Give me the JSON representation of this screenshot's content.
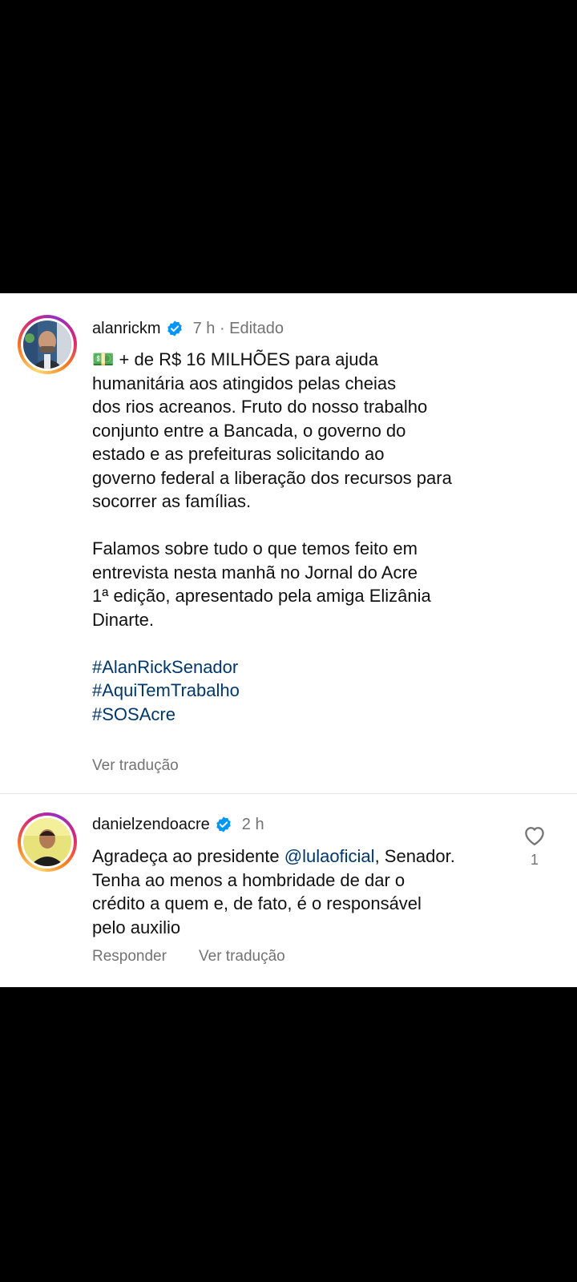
{
  "post": {
    "username": "alanrickm",
    "meta": "7 h · Editado",
    "emoji": "💵",
    "lines": [
      "+ de R$ 16 MILHÕES para ajuda",
      "humanitária aos atingidos pelas cheias",
      "dos rios acreanos. Fruto do nosso trabalho",
      "conjunto entre a Bancada, o governo do",
      "estado e as prefeituras solicitando ao",
      "governo federal a liberação dos recursos para",
      "socorrer as famílias."
    ],
    "lines2": [
      "Falamos sobre tudo o que temos feito em",
      "entrevista nesta manhã no Jornal do Acre",
      "1ª edição, apresentado pela amiga Elizânia",
      "Dinarte."
    ],
    "hashtags": [
      "#AlanRickSenador",
      "#AquiTemTrabalho",
      "#SOSAcre"
    ],
    "translate_label": "Ver tradução"
  },
  "comment": {
    "username": "danielzendoacre",
    "meta": "2 h",
    "text_before_mention": "Agradeça ao presidente ",
    "mention": "@lulaoficial",
    "text_after_mention": ", Senador.",
    "lines": [
      "Tenha ao menos a hombridade de dar o",
      "crédito a quem e, de fato, é o responsável",
      "pelo auxilio"
    ],
    "reply_label": "Responder",
    "translate_label": "Ver tradução",
    "like_count": "1"
  },
  "colors": {
    "verified": "#0095f6",
    "link": "#00376b",
    "secondary": "#737373"
  }
}
